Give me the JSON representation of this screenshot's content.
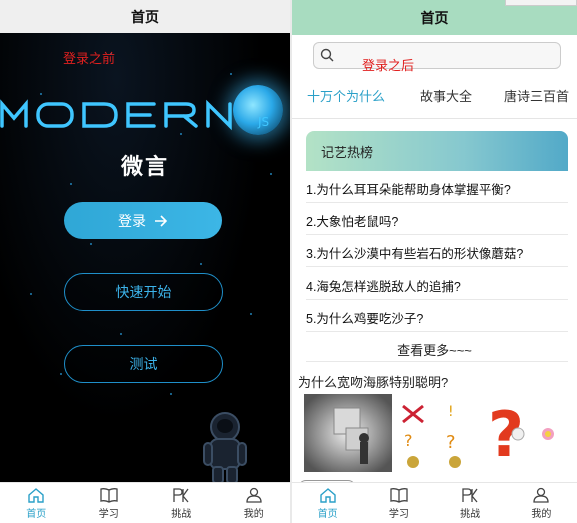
{
  "left": {
    "nav_title": "首页",
    "annotation": "登录之前",
    "logo_text": "MODERN JS",
    "app_name": "微言",
    "login_label": "登录",
    "quick_start_label": "快速开始",
    "test_label": "测试"
  },
  "right": {
    "nav_title": "首页",
    "annotation": "登录之后",
    "search_placeholder": "",
    "categories": [
      "十万个为什么",
      "故事大全",
      "唐诗三百首"
    ],
    "hot_title": "记艺热榜",
    "questions": [
      "1.为什么耳耳朵能帮助身体掌握平衡?",
      "2.大象怕老鼠吗?",
      "3.为什么沙漠中有些岩石的形状像蘑菇?",
      "4.海兔怎样逃脱敌人的追捕?",
      "5.为什么鸡要吃沙子?"
    ],
    "see_more": "查看更多~~~",
    "article_title": "为什么宽吻海豚特别聪明?"
  },
  "tabbar": {
    "items": [
      "首页",
      "学习",
      "挑战",
      "我的"
    ]
  },
  "colors": {
    "accent": "#2aa0c8",
    "right_nav_bg": "#a8dcc0",
    "annotation_red": "#e0201f"
  }
}
